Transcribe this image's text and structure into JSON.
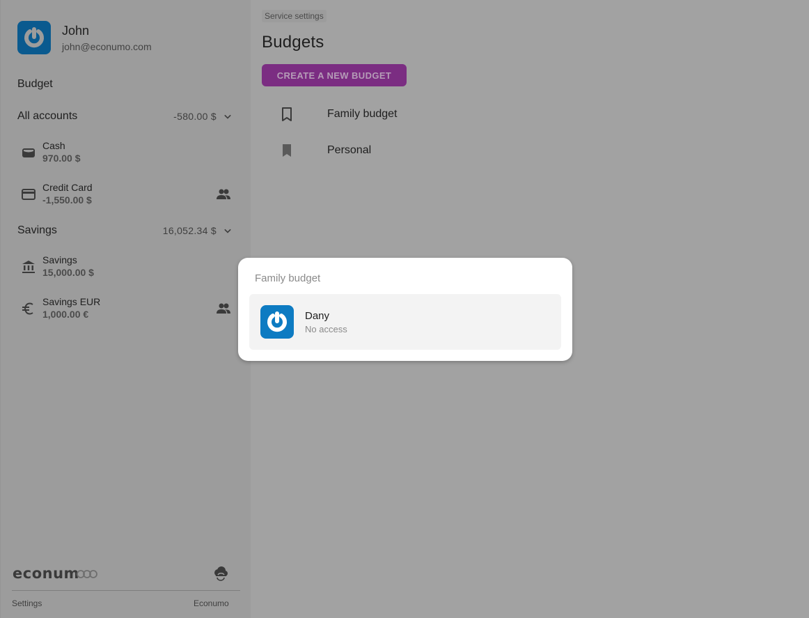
{
  "user": {
    "name": "John",
    "email": "john@econumo.com"
  },
  "sidebar": {
    "section_title": "Budget",
    "groups": [
      {
        "name": "All accounts",
        "total": "-580.00 $",
        "accounts": [
          {
            "name": "Cash",
            "balance": "970.00 $",
            "icon": "wallet-icon",
            "shared": false
          },
          {
            "name": "Credit Card",
            "balance": "-1,550.00 $",
            "icon": "credit-card-icon",
            "shared": true
          }
        ]
      },
      {
        "name": "Savings",
        "total": "16,052.34 $",
        "accounts": [
          {
            "name": "Savings",
            "balance": "15,000.00 $",
            "icon": "bank-icon",
            "shared": false
          },
          {
            "name": "Savings EUR",
            "balance": "1,000.00 €",
            "icon": "euro-icon",
            "shared": true
          }
        ]
      }
    ],
    "footer": {
      "logo_text": "econum",
      "settings_link": "Settings",
      "app_link": "Econumo"
    }
  },
  "main": {
    "breadcrumb": "Service settings",
    "title": "Budgets",
    "create_button": "CREATE A NEW BUDGET",
    "budgets": [
      {
        "name": "Family budget",
        "icon": "bookmark-outline-icon"
      },
      {
        "name": "Personal",
        "icon": "bookmark-filled-icon"
      }
    ]
  },
  "dialog": {
    "title": "Family budget",
    "users": [
      {
        "name": "Dany",
        "access": "No access"
      }
    ]
  },
  "colors": {
    "accent": "#7b2d82",
    "avatar_blue": "#0d7bc2",
    "overlay_gray": "#a2a2a2"
  }
}
